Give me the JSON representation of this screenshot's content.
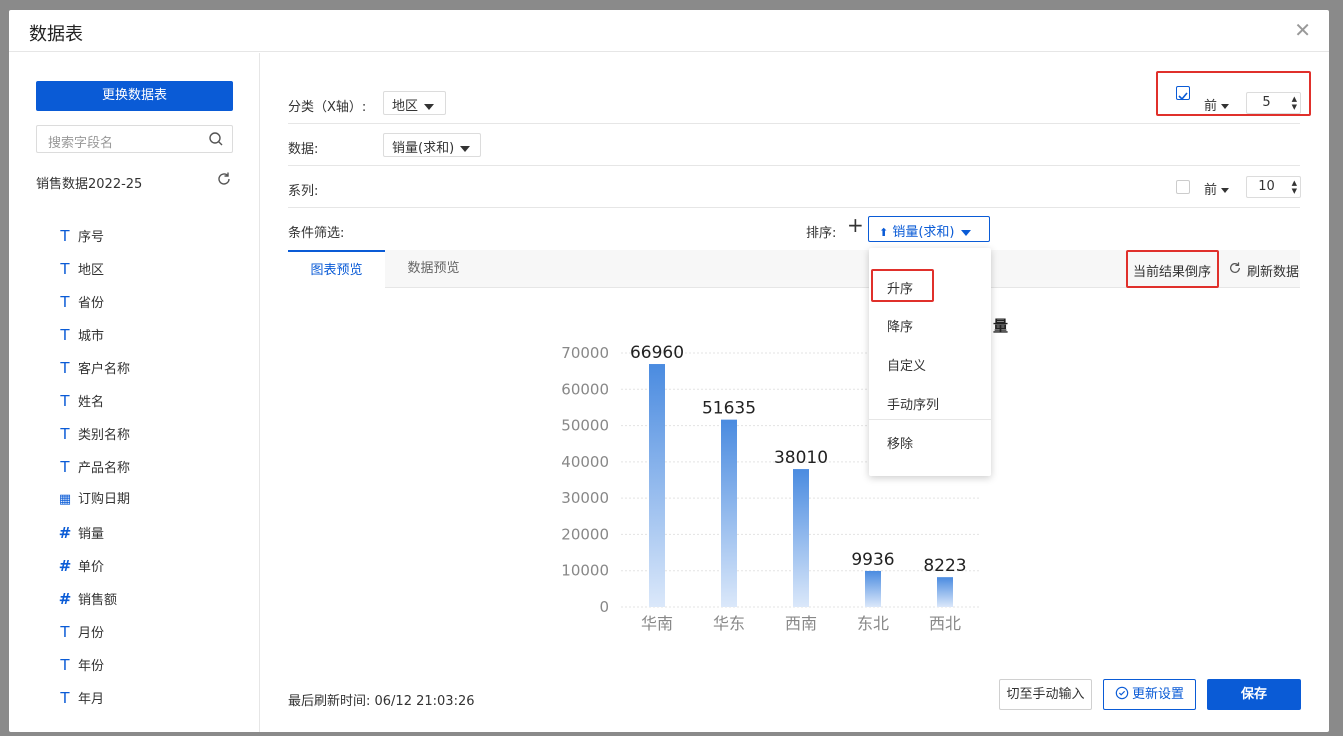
{
  "dialog": {
    "title": "数据表",
    "close_icon": "close-icon"
  },
  "sidebar": {
    "change_table_label": "更换数据表",
    "search_placeholder": "搜索字段名",
    "dataset_name": "销售数据2022-25",
    "fields": [
      {
        "label": "序号",
        "type": "text"
      },
      {
        "label": "地区",
        "type": "text"
      },
      {
        "label": "省份",
        "type": "text"
      },
      {
        "label": "城市",
        "type": "text"
      },
      {
        "label": "客户名称",
        "type": "text"
      },
      {
        "label": "姓名",
        "type": "text"
      },
      {
        "label": "类别名称",
        "type": "text"
      },
      {
        "label": "产品名称",
        "type": "text"
      },
      {
        "label": "订购日期",
        "type": "date"
      },
      {
        "label": "销量",
        "type": "number"
      },
      {
        "label": "单价",
        "type": "number"
      },
      {
        "label": "销售额",
        "type": "number"
      },
      {
        "label": "月份",
        "type": "text"
      },
      {
        "label": "年份",
        "type": "text"
      },
      {
        "label": "年月",
        "type": "text"
      }
    ]
  },
  "config": {
    "category_label": "分类（X轴）:",
    "category_value": "地区",
    "data_label": "数据:",
    "data_value": "销量(求和)",
    "series_label": "系列:",
    "filter_label": "条件筛选:",
    "sort_label": "排序:",
    "sort_value": "销量(求和)",
    "top_label": "前",
    "top_n_category": "5",
    "top_n_series": "10"
  },
  "tabs": {
    "chart_preview": "图表预览",
    "data_preview": "数据预览"
  },
  "actions": {
    "reverse_label": "当前结果倒序",
    "refresh_label": "刷新数据"
  },
  "sort_menu": {
    "asc": "升序",
    "desc": "降序",
    "custom": "自定义",
    "manual": "手动序列",
    "remove": "移除"
  },
  "chart_data": {
    "type": "bar",
    "title_fragment": "量",
    "categories": [
      "华南",
      "华东",
      "西南",
      "东北",
      "西北"
    ],
    "values": [
      66960,
      51635,
      38010,
      9936,
      8223
    ],
    "yticks": [
      "70000",
      "60000",
      "50000",
      "40000",
      "30000",
      "20000",
      "10000",
      "0"
    ],
    "ylim": [
      0,
      70000
    ],
    "bar_color": "#4a8be0"
  },
  "footer": {
    "last_refresh": "最后刷新时间: 06/12 21:03:26",
    "manual_input_label": "切至手动输入",
    "update_settings_label": "更新设置",
    "save_label": "保存"
  }
}
